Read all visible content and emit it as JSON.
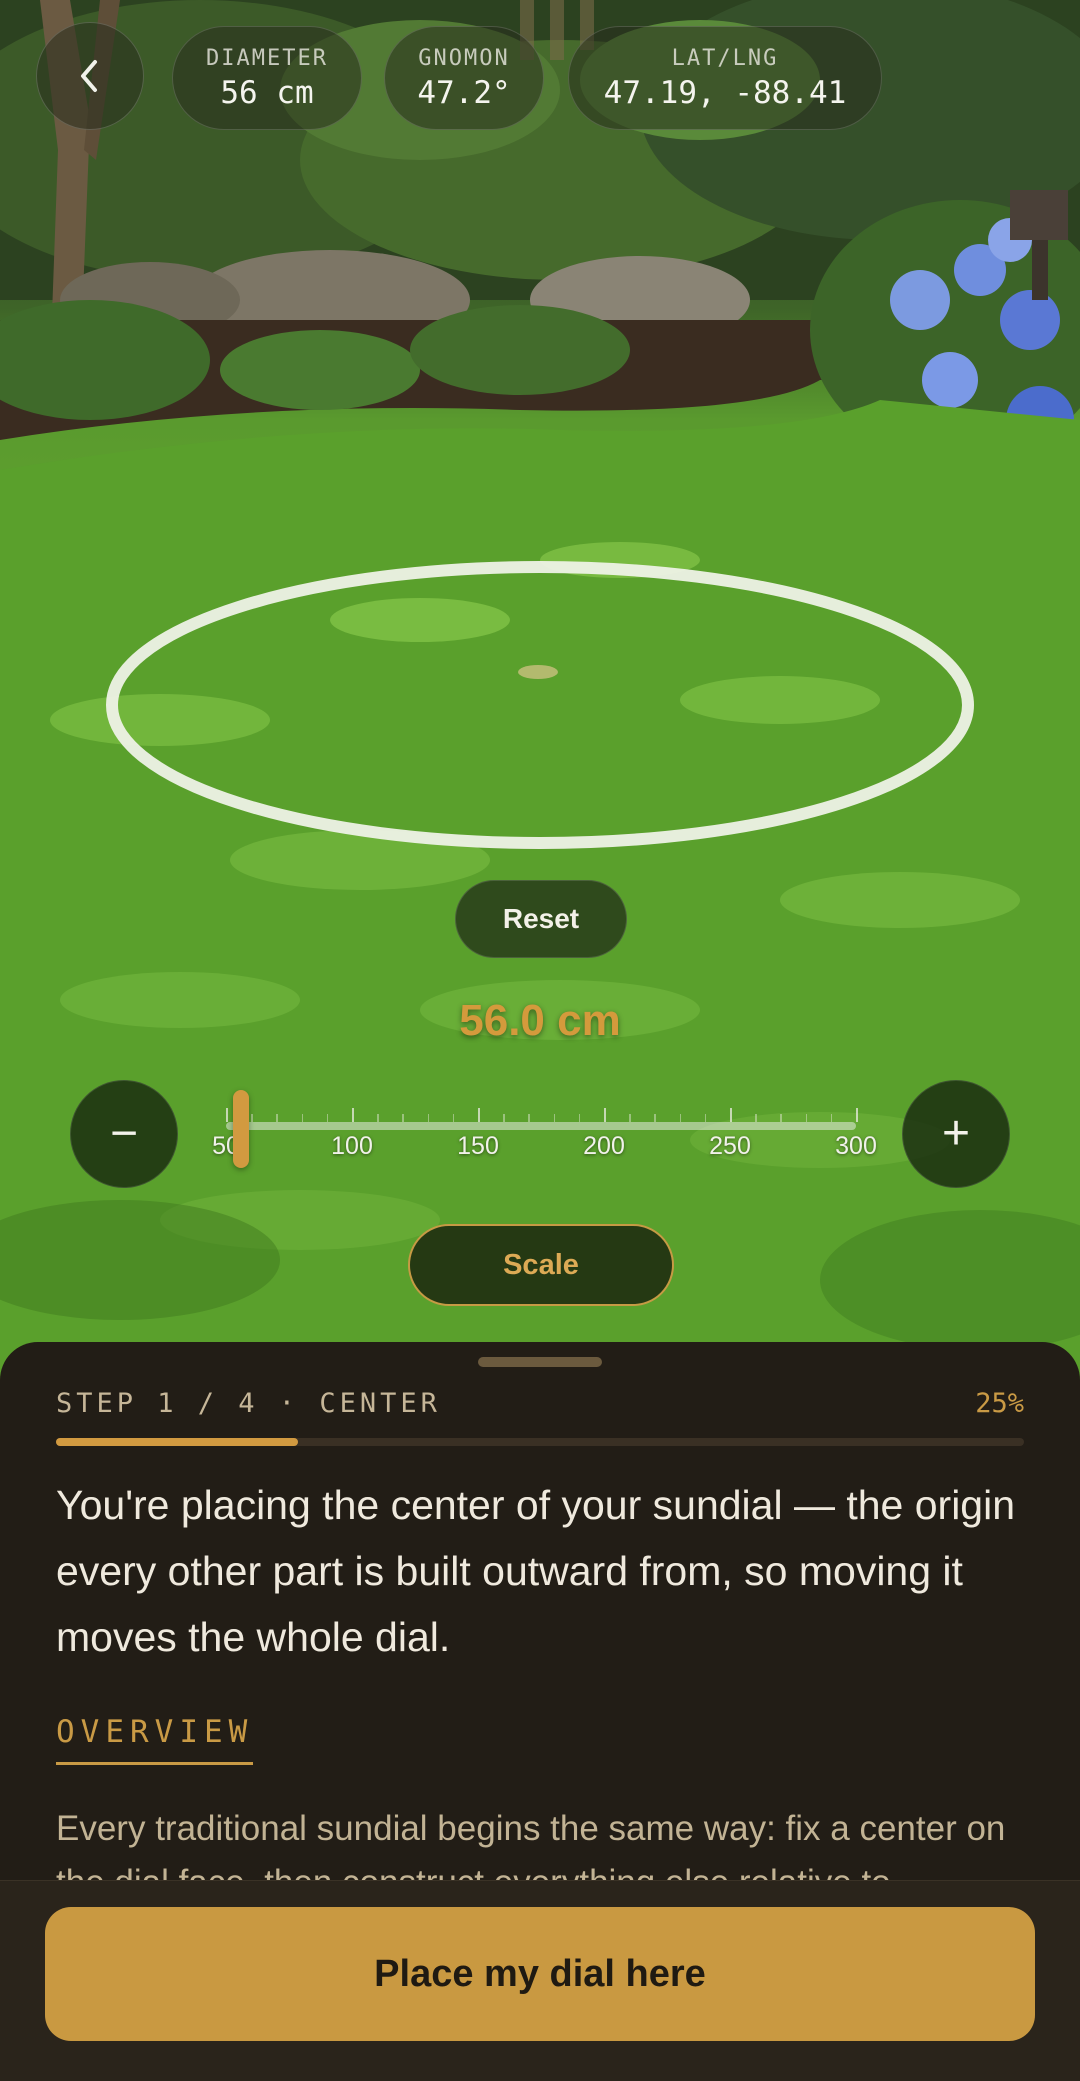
{
  "header": {
    "back_icon": "chevron-left-icon",
    "chips": {
      "diameter": {
        "label": "DIAMETER",
        "value": "56 cm"
      },
      "gnomon": {
        "label": "GNOMON",
        "value": "47.2°"
      },
      "latlng": {
        "label": "LAT/LNG",
        "value": "47.19, -88.41"
      }
    }
  },
  "placement": {
    "reset_label": "Reset",
    "size_readout": "56.0 cm"
  },
  "size_slider": {
    "min": 50,
    "max": 300,
    "value": 56,
    "tick_labels": [
      "50",
      "100",
      "150",
      "200",
      "250",
      "300"
    ],
    "minus_symbol": "−",
    "plus_symbol": "+"
  },
  "scale_label": "Scale",
  "sheet": {
    "step_label": "STEP 1 / 4 · CENTER",
    "percent_label": "25%",
    "progress": 0.25,
    "intro": "You're placing the center of your sundial — the origin every other part is built outward from, so moving it moves the whole dial.",
    "section_title": "OVERVIEW",
    "overview": "Every traditional sundial begins the same way: fix a center on the dial face, then construct everything else relative to"
  },
  "cta_label": "Place my dial here",
  "colors": {
    "accent": "#c99941",
    "sheet_bg": "#221d16",
    "ring": "#eef2e6"
  }
}
